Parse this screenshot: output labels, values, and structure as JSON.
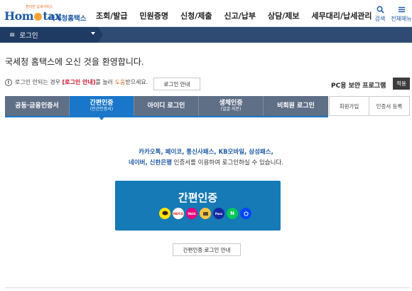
{
  "header": {
    "logo_slogan": "편리한 납세서비스",
    "logo_text": "Hometax",
    "logo_korean": "국세청홈택스",
    "nav": [
      "조회/발급",
      "민원증명",
      "신청/제출",
      "신고/납부",
      "상담/제보",
      "세무대리/납세관리"
    ],
    "util_search": "검색",
    "util_menu": "전체메뉴"
  },
  "breadcrumb": {
    "label": "로그인"
  },
  "welcome": "국세청 홈택스에 오신 것을 환영합니다.",
  "notice": {
    "prefix": "로그인 안되는 경우",
    "highlight": "[로그인 안내]",
    "middle": "를 눌러",
    "help": "도움",
    "suffix": "받으세요.",
    "guide_button": "로그인 안내"
  },
  "pc_security": {
    "label": "PC용 보안 프로그램",
    "button": "적용"
  },
  "tabs": [
    {
      "label": "공동·금융인증서",
      "sub": ""
    },
    {
      "label": "간편인증",
      "sub": "(민간인증서)"
    },
    {
      "label": "아이디 로그인",
      "sub": ""
    },
    {
      "label": "생체인증",
      "sub": "(얼굴·지문)"
    },
    {
      "label": "비회원 로그인",
      "sub": ""
    }
  ],
  "ext_links": [
    "회원가입",
    "인증서 등록"
  ],
  "description": {
    "line1": "카카오톡, 페이코, 통신사패스, KB모바일, 삼성패스,",
    "line2_hl": "네이버, 신한은행",
    "line2_rest": " 인증서를 이용하여 로그인하실 수 있습니다."
  },
  "easy_auth": {
    "title": "간편인증",
    "providers": [
      "kakao",
      "PAYCO",
      "PASS",
      "pass",
      "KB",
      "Pass",
      "N",
      "신한"
    ]
  },
  "easy_guide_button": "간편인증 로그인 안내",
  "colors": {
    "primary": "#1976c8",
    "tab_inactive": "#5e6f86",
    "bar": "#2f4a73",
    "easy_box": "#157ab5"
  }
}
